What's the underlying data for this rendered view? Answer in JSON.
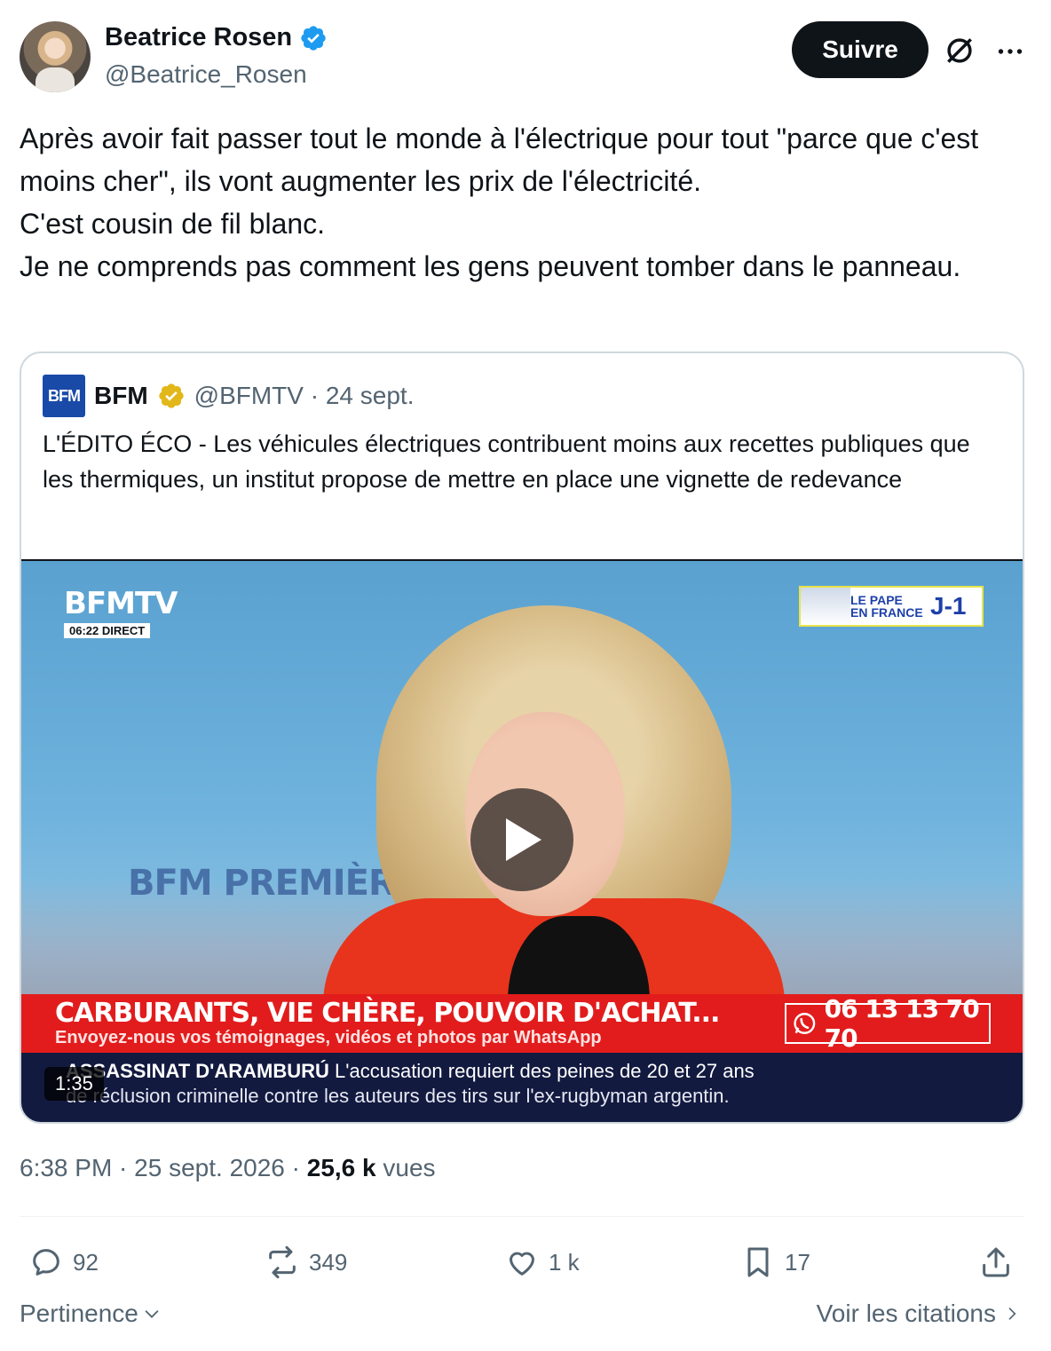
{
  "author": {
    "display_name": "Beatrice Rosen",
    "handle": "@Beatrice_Rosen",
    "verified_icon": "verified-blue-badge-icon"
  },
  "follow_label": "Suivre",
  "tweet_text": [
    "Après avoir fait passer tout le monde à l'électrique pour tout \"parce que c'est moins cher\", ils vont augmenter les prix de l'électricité.",
    "C'est cousin de fil blanc.",
    "Je ne comprends pas comment les gens peuvent tomber dans le panneau."
  ],
  "quote": {
    "logo_text": "BFM",
    "name": "BFM",
    "handle_date": "@BFMTV · 24 sept.",
    "text": "L'ÉDITO ÉCO - Les véhicules électriques contribuent moins aux recettes publiques que les thermiques, un institut propose de mettre en place une vignette de redevance",
    "video": {
      "channel": "BFMTV",
      "live_time": "06:22  DIRECT",
      "pape_label_1": "LE PAPE",
      "pape_label_2": "EN FRANCE",
      "pape_countdown": "J-1",
      "background_text": "BFM PREMIÈRE",
      "red_title": "CARBURANTS, VIE CHÈRE, POUVOIR D'ACHAT...",
      "red_sub": "Envoyez-nous vos témoignages, vidéos et photos par WhatsApp",
      "phone": "06 13 13 70 70",
      "ticker_bold": "ASSASSINAT D'ARAMBURÚ",
      "ticker_rest": " L'accusation requiert des peines de 20 et 27 ans",
      "ticker_line2": "de réclusion criminelle contre les auteurs des tirs sur l'ex-rugbyman argentin.",
      "duration": "1:35"
    }
  },
  "meta": {
    "time_date": "6:38 PM · 25 sept. 2026 · ",
    "views_count": "25,6 k",
    "views_label": " vues"
  },
  "actions": {
    "replies": "92",
    "reposts": "349",
    "likes": "1 k",
    "bookmarks": "17"
  },
  "footer": {
    "sort_label": "Pertinence",
    "quotes_label": "Voir les citations"
  },
  "colors": {
    "follow_bg": "#0f1419",
    "verified_blue": "#1d9bf0",
    "verified_gold": "#e2b719",
    "secondary_text": "#536471",
    "bfm_red": "#e21c1c",
    "bfm_navy": "#131a40"
  }
}
